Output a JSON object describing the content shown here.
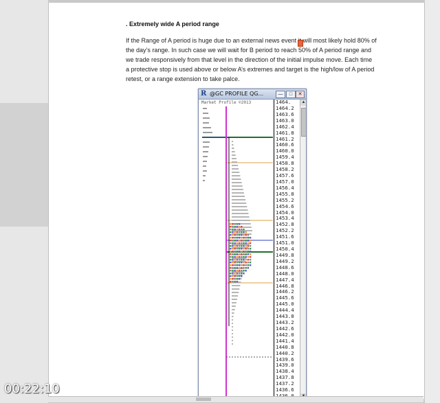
{
  "document": {
    "heading": ". Extremely wide A period range",
    "paragraph_lines": [
      "If the Range of A period is huge due to an external news event it will most likely hold 80% of",
      "the day’s range. In such case we will wait for B period to reach 50% of A period range and",
      "we trade responsively from that level in the direction of the initial impulse move. Each time",
      "a protective stop is used above or below A’s extremes and target is the high/low of A period",
      "retest, or a range extension to take palce."
    ]
  },
  "chart_window": {
    "app_icon": "R",
    "title": "@GC PROFILE QG...",
    "header_text": "Market Profile ©2013",
    "buttons": {
      "minimize": "—",
      "maximize": "□",
      "close": "✕"
    },
    "icons": [
      "app-icon",
      "minimize-icon",
      "maximize-icon",
      "close-icon",
      "scroll-up-icon",
      "scroll-down-icon"
    ],
    "price_ticks": [
      "1464.",
      "1464.2",
      "1463.6",
      "1463.0",
      "1462.4",
      "1461.8",
      "1461.2",
      "1460.6",
      "1460.0",
      "1459.4",
      "1458.8",
      "1458.2",
      "1457.6",
      "1457.0",
      "1456.4",
      "1455.8",
      "1455.2",
      "1454.6",
      "1454.0",
      "1453.4",
      "1452.8",
      "1452.2",
      "1451.6",
      "1451.0",
      "1450.4",
      "1449.8",
      "1449.2",
      "1448.6",
      "1448.0",
      "1447.4",
      "1446.8",
      "1446.2",
      "1445.6",
      "1445.0",
      "1444.4",
      "1443.8",
      "1443.2",
      "1442.6",
      "1442.0",
      "1441.4",
      "1440.8",
      "1440.2",
      "1439.6",
      "1439.0",
      "1438.4",
      "1437.8",
      "1437.2",
      "1436.6",
      "1436.0"
    ],
    "colors": {
      "magenta_line": "#d12fd1",
      "green_line": "#1f6f2a",
      "orange_line": "#e0a040",
      "blue_line": "#2c3fbf",
      "profile_gray": "#9a9a9a"
    }
  },
  "video_timer": "00:22:10"
}
